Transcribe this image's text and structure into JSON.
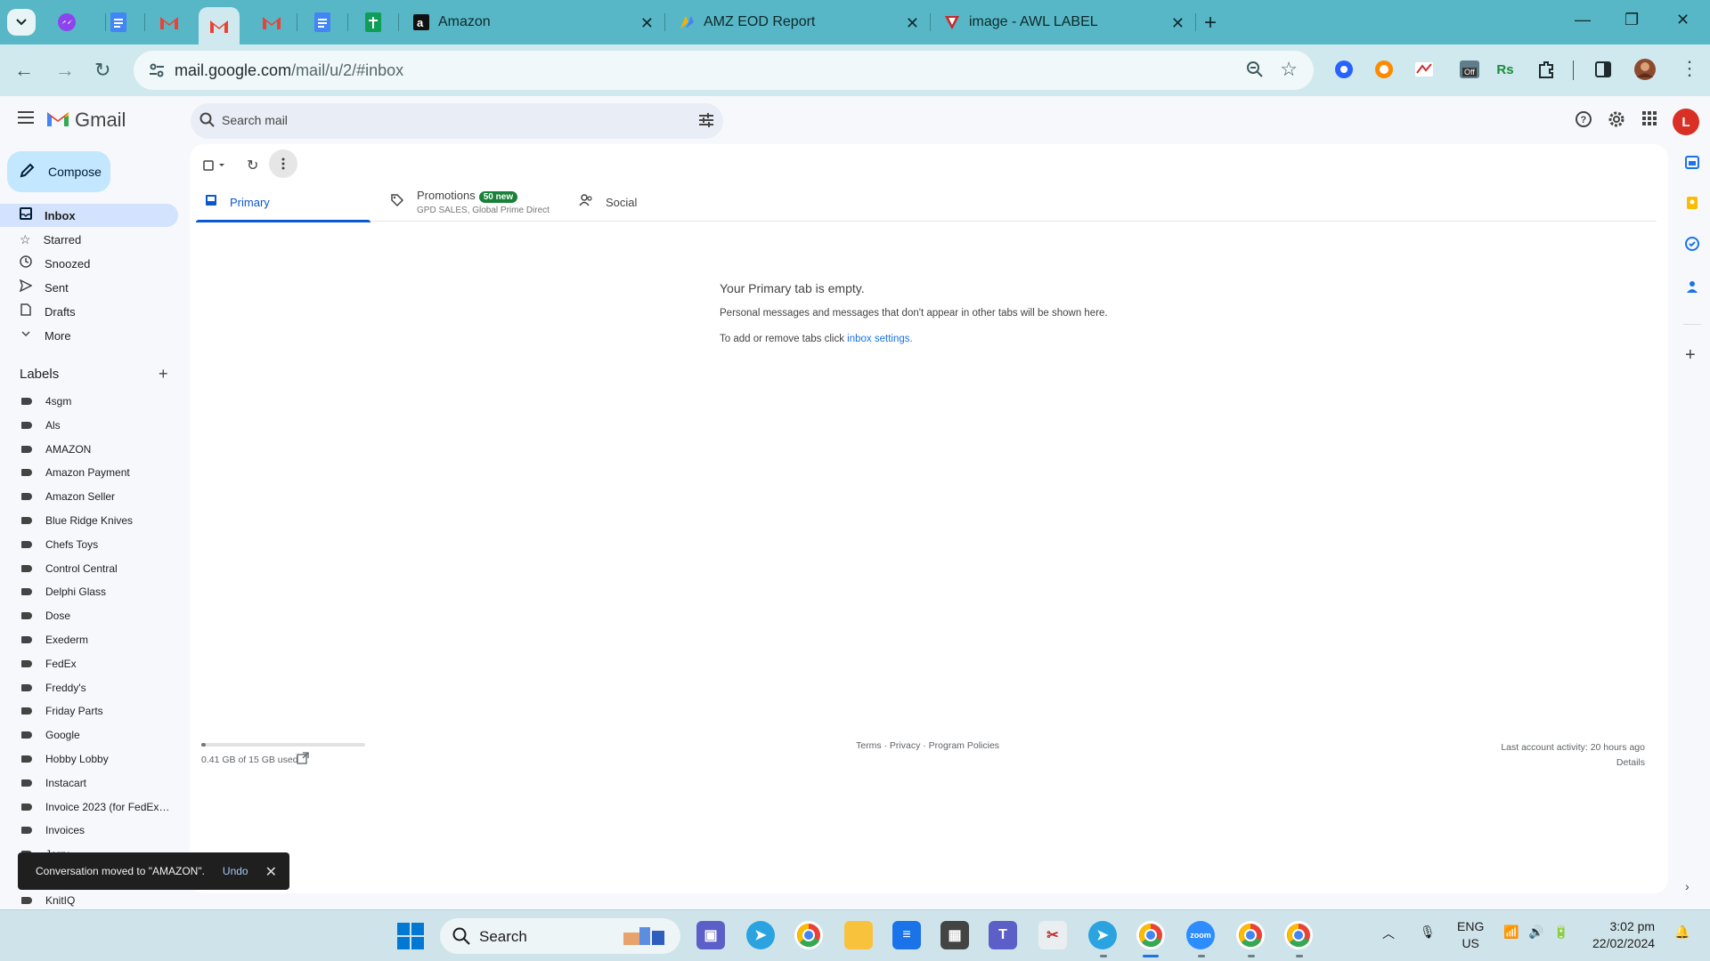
{
  "browser": {
    "tabs": [
      {
        "title": "Amazon",
        "icon": "amazon-icon"
      },
      {
        "title": "AMZ EOD Report",
        "icon": "report-icon"
      },
      {
        "title": "image - AWL LABEL",
        "icon": "awl-icon"
      }
    ],
    "url_host": "mail.google.com",
    "url_path": "/mail/u/2/#inbox",
    "extension_badge": "Off"
  },
  "gmail": {
    "brand": "Gmail",
    "search_placeholder": "Search mail",
    "compose_label": "Compose",
    "avatar_letter": "L",
    "nav": [
      {
        "label": "Inbox",
        "icon": "inbox-icon",
        "active": true
      },
      {
        "label": "Starred",
        "icon": "star-icon"
      },
      {
        "label": "Snoozed",
        "icon": "clock-icon"
      },
      {
        "label": "Sent",
        "icon": "send-icon"
      },
      {
        "label": "Drafts",
        "icon": "draft-icon"
      },
      {
        "label": "More",
        "icon": "chevron-down-icon"
      }
    ],
    "labels_heading": "Labels",
    "labels": [
      "4sgm",
      "Als",
      "AMAZON",
      "Amazon Payment",
      "Amazon Seller",
      "Blue Ridge Knives",
      "Chefs Toys",
      "Control Central",
      "Delphi Glass",
      "Dose",
      "Exederm",
      "FedEx",
      "Freddy's",
      "Friday Parts",
      "Google",
      "Hobby Lobby",
      "Instacart",
      "Invoice 2023 (for FedEx ...",
      "Invoices"
    ],
    "label_partial": "Jerry",
    "label_last": "KnitIQ",
    "tabs": {
      "primary": "Primary",
      "promotions": "Promotions",
      "promotions_badge": "50 new",
      "promotions_sub": "GPD SALES, Global Prime Direct",
      "social": "Social"
    },
    "empty": {
      "title": "Your Primary tab is empty.",
      "line1": "Personal messages and messages that don't appear in other tabs will be shown here.",
      "line2_prefix": "To add or remove tabs click ",
      "line2_link": "inbox settings",
      "line2_suffix": "."
    },
    "storage": {
      "text": "0.41 GB of 15 GB used",
      "fraction": 0.027
    },
    "footer_links": "Terms · Privacy · Program Policies",
    "activity": "Last account activity: 20 hours ago",
    "details": "Details",
    "snackbar": {
      "message": "Conversation moved to \"AMAZON\".",
      "action": "Undo"
    }
  },
  "taskbar": {
    "search_placeholder": "Search",
    "lang_top": "ENG",
    "lang_bottom": "US",
    "time": "3:02 pm",
    "date": "22/02/2024"
  },
  "colors": {
    "accent": "#0b57d0",
    "chrome_tab": "#57b7c6",
    "compose": "#c2e7ff"
  }
}
